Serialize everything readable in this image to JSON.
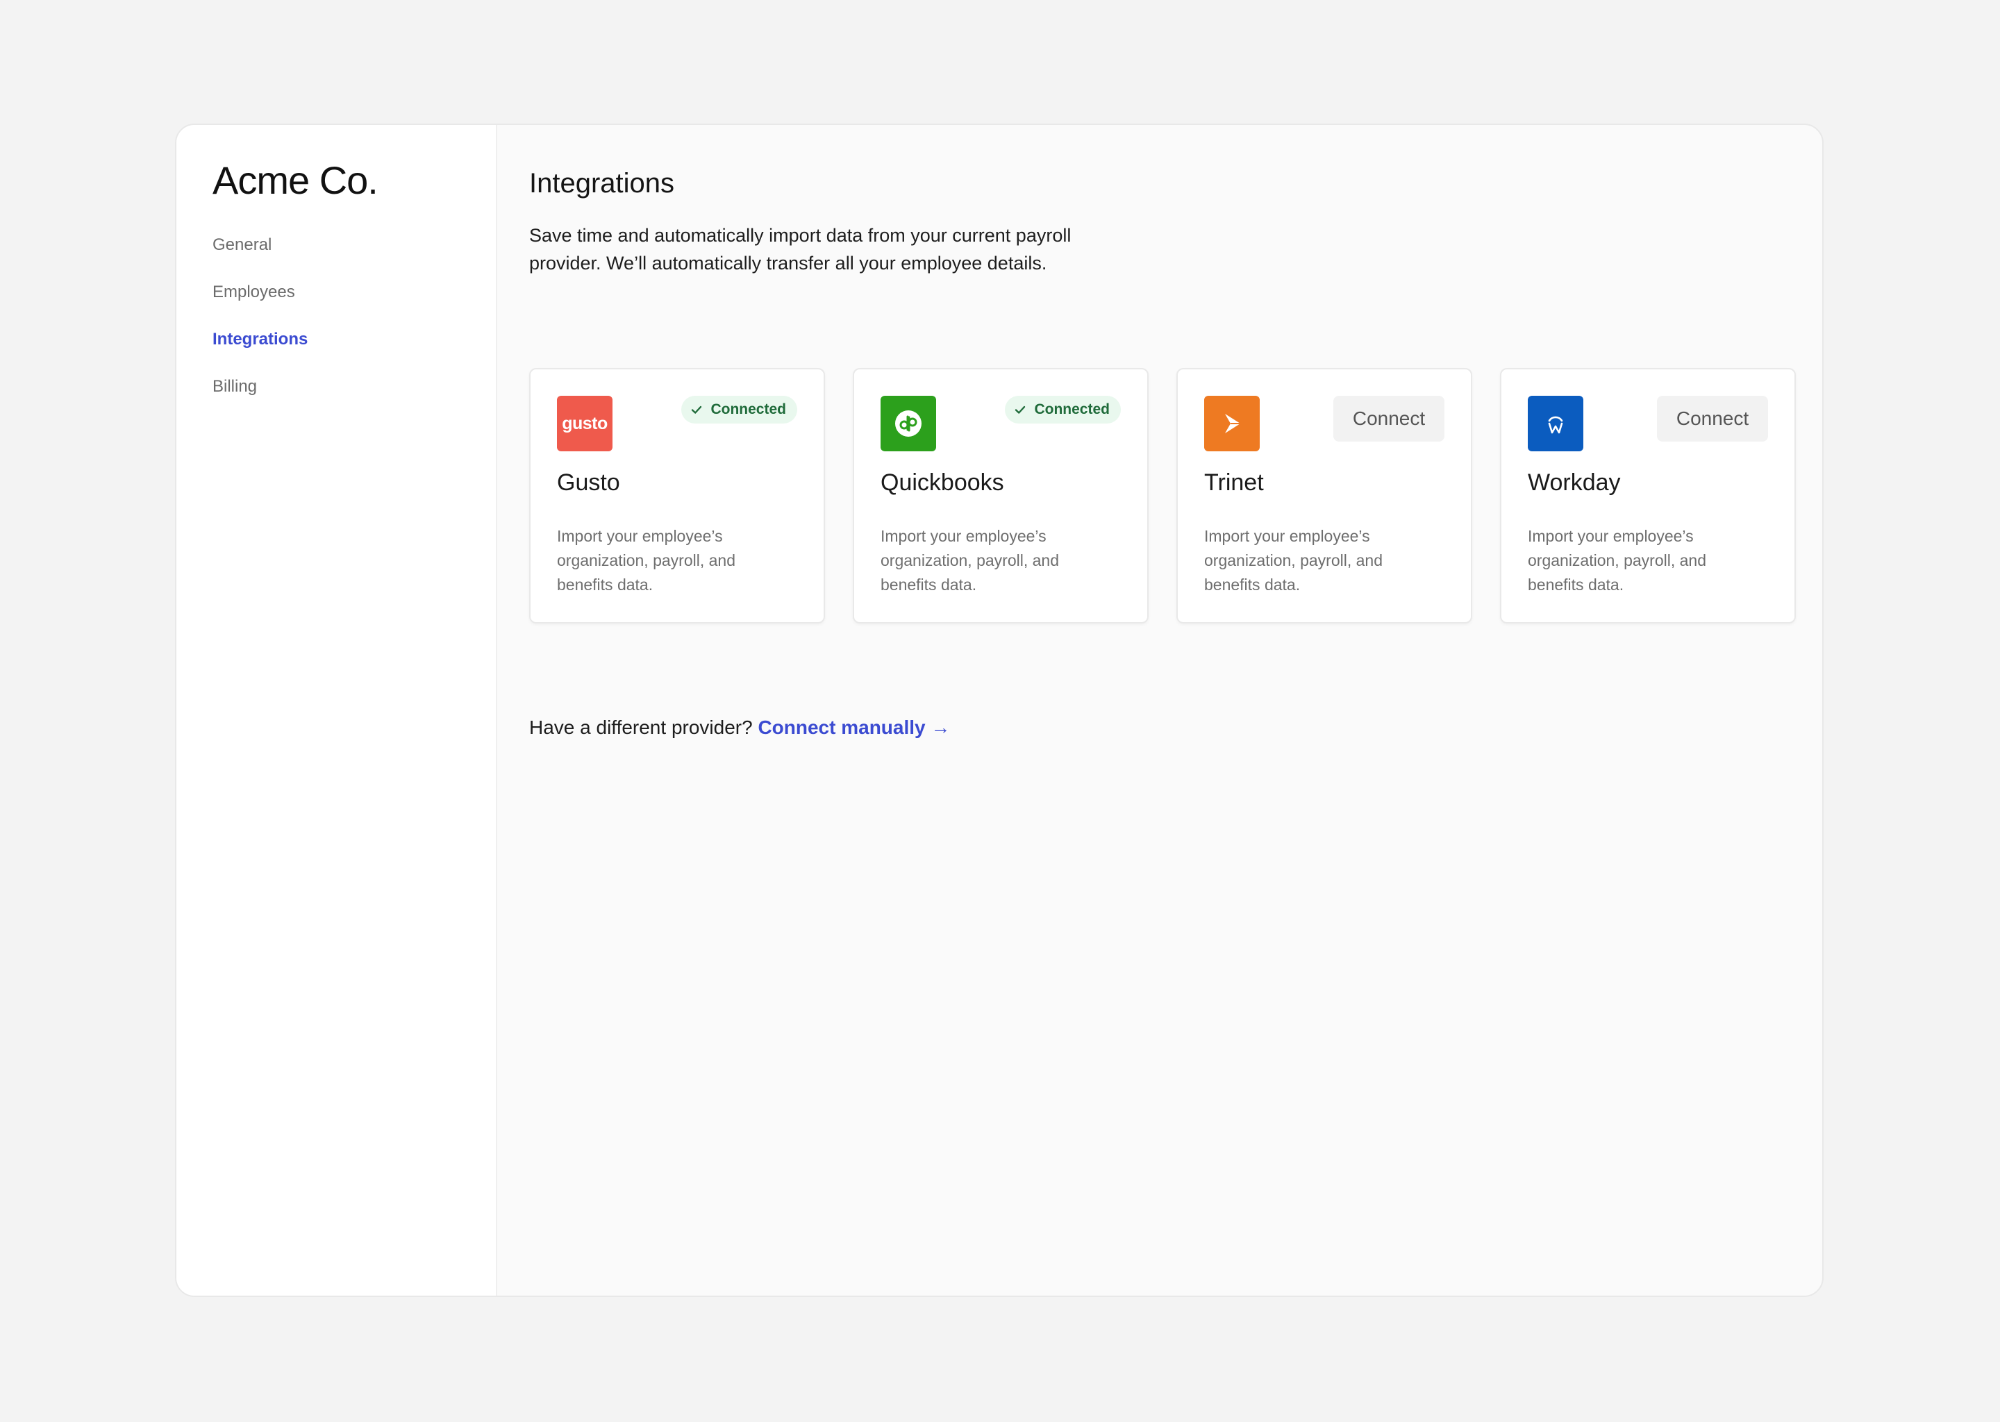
{
  "sidebar": {
    "brand": "Acme Co.",
    "items": [
      {
        "label": "General",
        "active": false
      },
      {
        "label": "Employees",
        "active": false
      },
      {
        "label": "Integrations",
        "active": true
      },
      {
        "label": "Billing",
        "active": false
      }
    ]
  },
  "main": {
    "title": "Integrations",
    "description": "Save time and automatically import data from your current payroll provider. We’ll automatically transfer all your employee details.",
    "cards": [
      {
        "name": "Gusto",
        "logo_text": "gusto",
        "logo_color": "#ef5a4c",
        "status": "Connected",
        "description": "Import your employee’s organization, payroll, and benefits data."
      },
      {
        "name": "Quickbooks",
        "logo_icon": "quickbooks-logo-icon",
        "logo_color": "#2ca01c",
        "status": "Connected",
        "description": "Import your employee’s organization, payroll, and benefits data."
      },
      {
        "name": "Trinet",
        "logo_icon": "trinet-logo-icon",
        "logo_color": "#ee7a22",
        "action": "Connect",
        "description": "Import your employee’s organization, payroll, and benefits data."
      },
      {
        "name": "Workday",
        "logo_icon": "workday-logo-icon",
        "logo_color": "#0b5cbf",
        "action": "Connect",
        "description": "Import your employee’s organization, payroll, and benefits data."
      }
    ],
    "footer": {
      "prompt": "Have a different provider?",
      "link_label": "Connect manually →"
    }
  },
  "colors": {
    "accent": "#3b4bd1",
    "connected_bg": "#e9f8ee",
    "connected_text": "#1f6b3a"
  }
}
